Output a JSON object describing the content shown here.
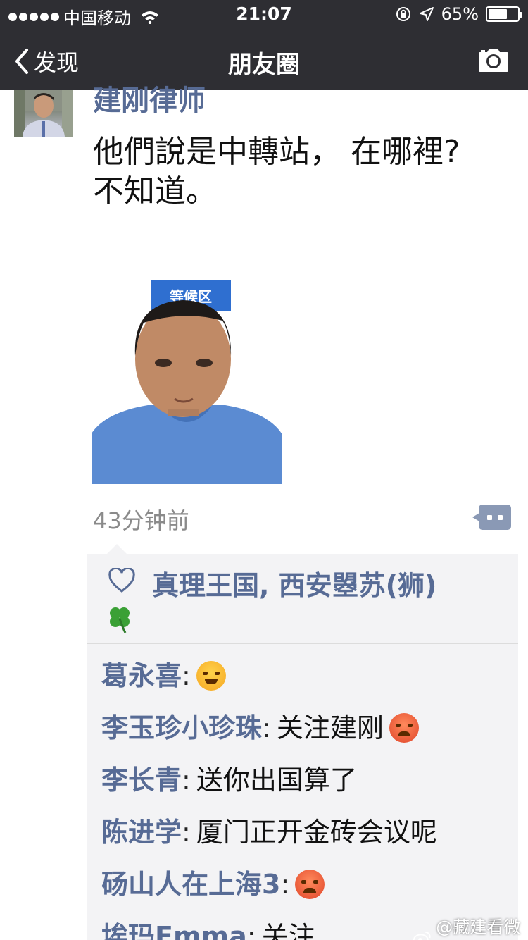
{
  "status_bar": {
    "carrier": "中国移动",
    "time": "21:07",
    "battery_percent": "65%",
    "battery_level": 0.65
  },
  "nav": {
    "back_label": "发现",
    "title": "朋友圈",
    "camera_icon": "camera-icon"
  },
  "post": {
    "author": "建刚律师",
    "text_line1": "他們說是中轉站， 在哪裡?",
    "text_line2": "不知道。",
    "photo_sign": "等候区",
    "time_ago": "43分钟前"
  },
  "likes": {
    "names": "真理王国, 西安曌苏(狮)",
    "icon": "heart-icon"
  },
  "comments": [
    {
      "name": "葛永喜",
      "sep": ":",
      "text": "",
      "emoji": "laughing-crying-emoji"
    },
    {
      "name": "李玉珍小珍珠",
      "sep": ":",
      "text": "关注建刚",
      "emoji": "angry-emoji"
    },
    {
      "name": "李长青",
      "sep": ":",
      "text": "送你出国算了",
      "emoji": ""
    },
    {
      "name": "陈进学",
      "sep": ":",
      "text": "厦门正开金砖会议呢",
      "emoji": ""
    },
    {
      "name": "砀山人在上海3",
      "sep": ":",
      "text": "",
      "emoji": "angry-emoji"
    },
    {
      "name": "埃玛Emma",
      "sep": ":",
      "text": "关注",
      "emoji": ""
    }
  ],
  "watermark": "@藏建看微博",
  "colors": {
    "bar_bg": "#2e2e33",
    "link_blue": "#576b95",
    "panel_bg": "#f3f3f5"
  }
}
